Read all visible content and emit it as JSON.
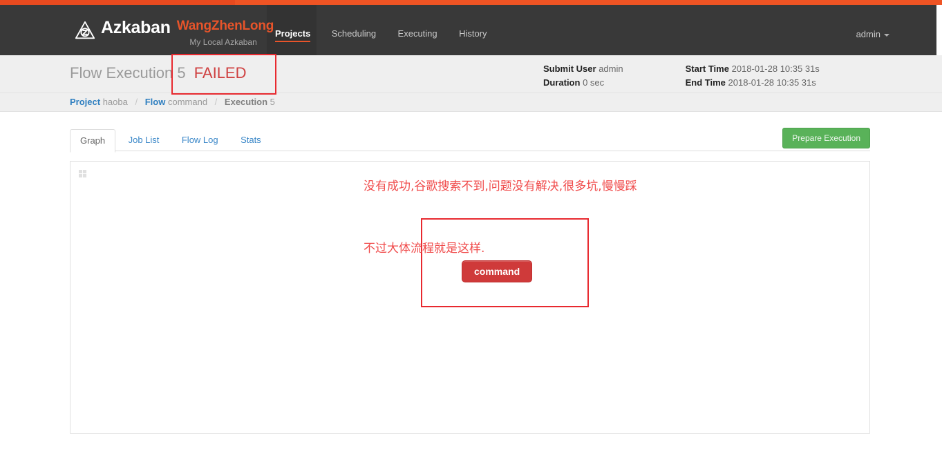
{
  "brand": {
    "logo_icon": "azkaban-logo-icon",
    "name": "Azkaban",
    "user": "WangZhenLong",
    "subtitle": "My Local Azkaban"
  },
  "nav": {
    "links": [
      {
        "label": "Projects",
        "active": true
      },
      {
        "label": "Scheduling",
        "active": false
      },
      {
        "label": "Executing",
        "active": false
      },
      {
        "label": "History",
        "active": false
      }
    ],
    "account": {
      "label": "admin",
      "caret_icon": "chevron-down-icon"
    }
  },
  "status": {
    "title_prefix": "Flow Execution",
    "execution_number": "5",
    "state": "FAILED",
    "state_color": "#cf4040"
  },
  "summary": {
    "submit_user_label": "Submit User",
    "submit_user_value": "admin",
    "duration_label": "Duration",
    "duration_value": "0 sec",
    "start_time_label": "Start Time",
    "start_time_value": "2018-01-28 10:35 31s",
    "end_time_label": "End Time",
    "end_time_value": "2018-01-28 10:35 31s"
  },
  "breadcrumb": {
    "project_label": "Project",
    "project_value": "haoba",
    "flow_label": "Flow",
    "flow_value": "command",
    "execution_label": "Execution",
    "execution_value": "5",
    "separator": "/"
  },
  "tabs": [
    {
      "label": "Graph",
      "active": true
    },
    {
      "label": "Job List",
      "active": false
    },
    {
      "label": "Flow Log",
      "active": false
    },
    {
      "label": "Stats",
      "active": false
    }
  ],
  "actions": {
    "prepare_execution": "Prepare Execution",
    "prepare_execution_color": "#59b259"
  },
  "graph": {
    "grid_icon": "grid-handle-icon",
    "nodes": [
      {
        "label": "command",
        "state": "failed",
        "color": "#cf3a3a"
      }
    ]
  },
  "annotations": {
    "marker_color": "#e8292f",
    "text_color": "#f04b4b",
    "line1": "没有成功,谷歌搜索不到,问题没有解决,很多坑,慢慢踩",
    "line2": "不过大体流程就是这样.",
    "boxes": [
      "title-status-highlight",
      "command-node-highlight"
    ]
  }
}
